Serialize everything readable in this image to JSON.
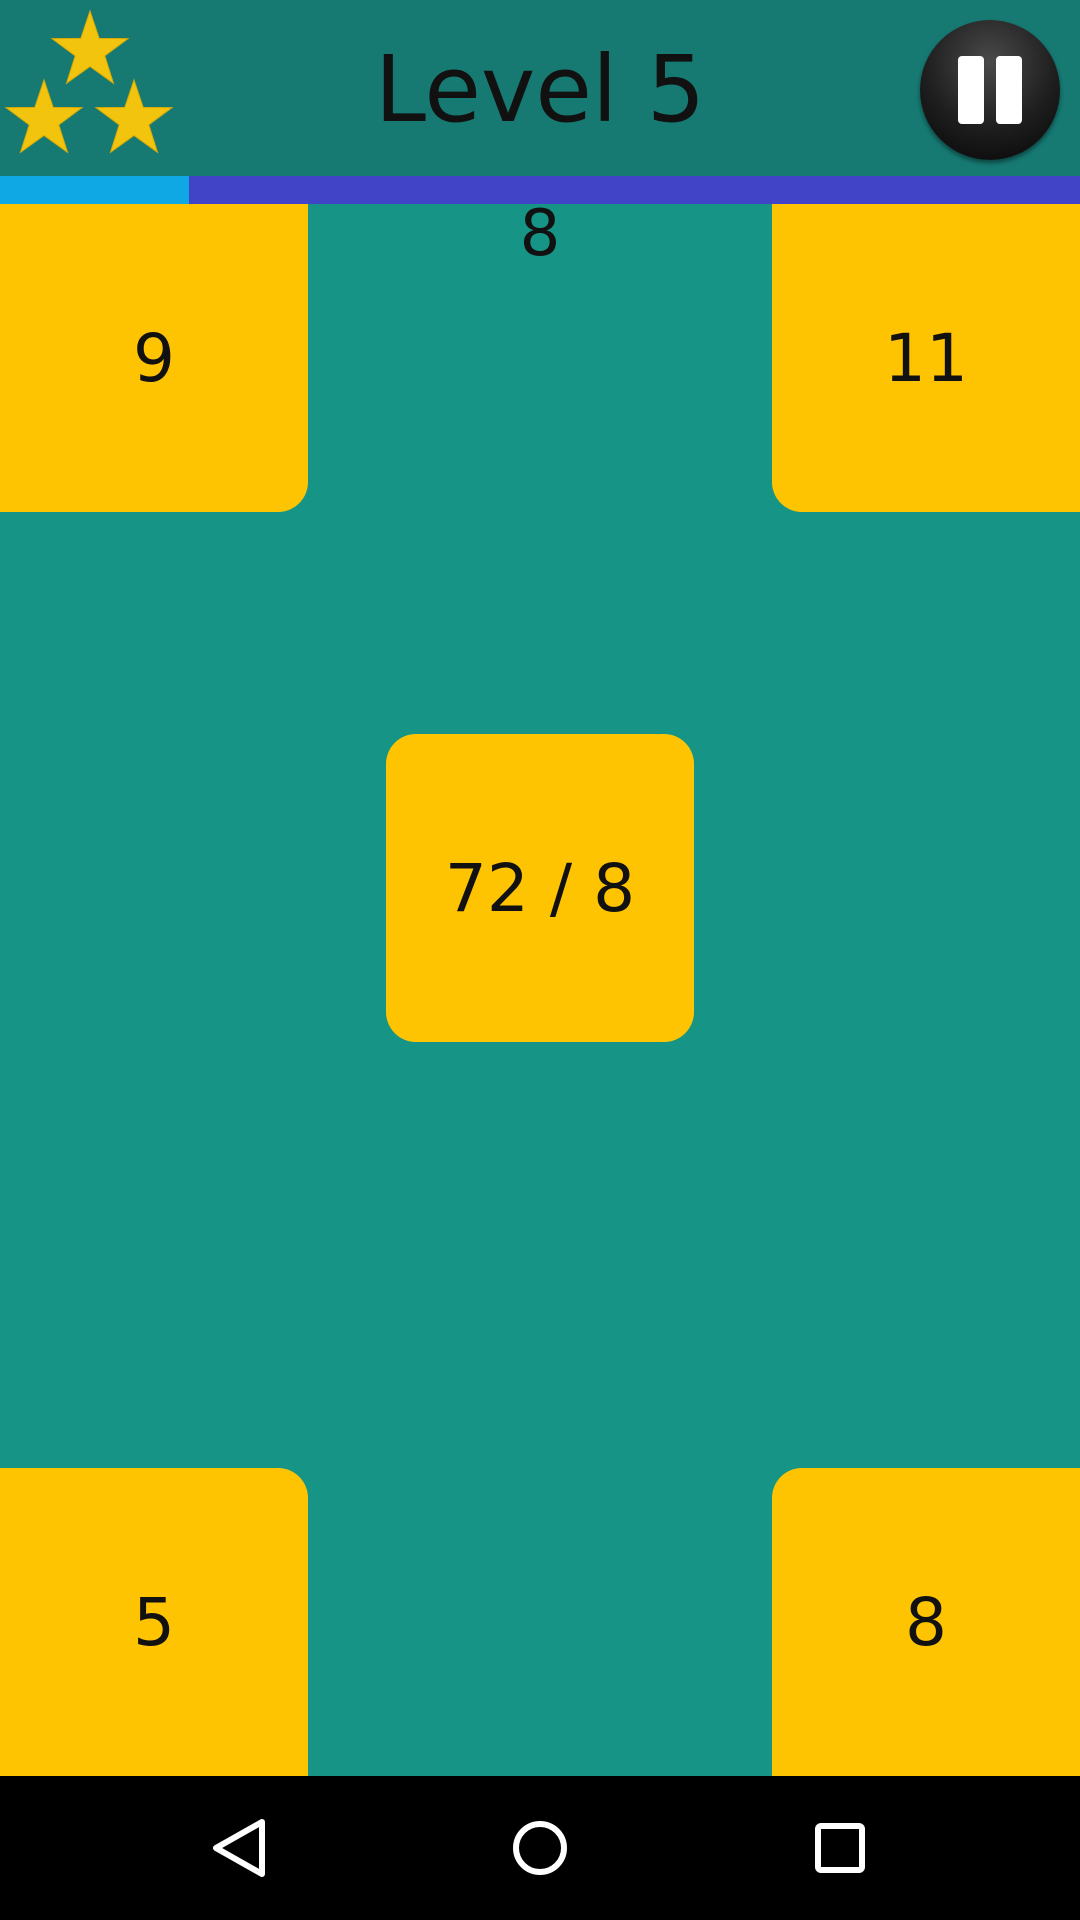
{
  "header": {
    "title": "Level 5",
    "stars_earned": 3,
    "star_color": "#f2c40d",
    "pause_icon": "pause-icon"
  },
  "progress": {
    "fraction": 0.175,
    "fill_color": "#10a8e4",
    "track_color": "#4244c7"
  },
  "game": {
    "target": "8",
    "tiles": {
      "top_left": "9",
      "top_right": "11",
      "center": "72 / 8",
      "bottom_left": "5",
      "bottom_right": "8"
    },
    "tile_color": "#ffc401",
    "background_color": "#169587"
  },
  "navbar": {
    "icons": [
      "back-icon",
      "home-icon",
      "recents-icon"
    ]
  }
}
